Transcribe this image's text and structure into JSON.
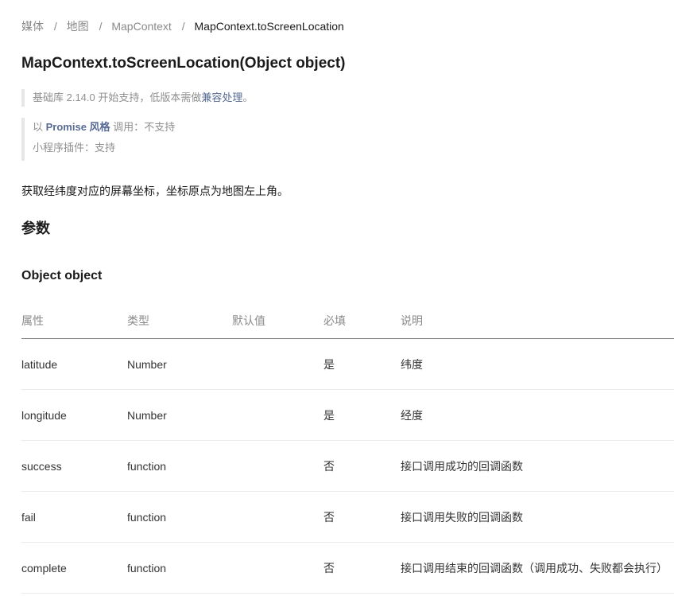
{
  "breadcrumb": {
    "items": [
      "媒体",
      "地图",
      "MapContext"
    ],
    "separator": "/",
    "current": "MapContext.toScreenLocation"
  },
  "title": "MapContext.toScreenLocation(Object object)",
  "support": {
    "prefix": "基础库 2.14.0 开始支持，低版本需做",
    "link": "兼容处理",
    "suffix": "。"
  },
  "promise": {
    "prefix": "以 ",
    "emphasis": "Promise 风格",
    "middle": " 调用",
    "colon": "：",
    "value": "不支持"
  },
  "plugin": {
    "label": "小程序插件",
    "colon": "：",
    "value": "支持"
  },
  "description": "获取经纬度对应的屏幕坐标，坐标原点为地图左上角。",
  "params_heading": "参数",
  "object_heading": "Object object",
  "table": {
    "headers": [
      "属性",
      "类型",
      "默认值",
      "必填",
      "说明"
    ],
    "rows": [
      {
        "name": "latitude",
        "type": "Number",
        "default": "",
        "required": "是",
        "desc": "纬度"
      },
      {
        "name": "longitude",
        "type": "Number",
        "default": "",
        "required": "是",
        "desc": "经度"
      },
      {
        "name": "success",
        "type": "function",
        "default": "",
        "required": "否",
        "desc": "接口调用成功的回调函数"
      },
      {
        "name": "fail",
        "type": "function",
        "default": "",
        "required": "否",
        "desc": "接口调用失败的回调函数"
      },
      {
        "name": "complete",
        "type": "function",
        "default": "",
        "required": "否",
        "desc": "接口调用结束的回调函数（调用成功、失败都会执行）"
      }
    ]
  },
  "colors": {
    "link": "#576b95",
    "muted": "#8a8a8a",
    "text": "#1a1a1a",
    "quote_border": "#e6e6e6"
  }
}
